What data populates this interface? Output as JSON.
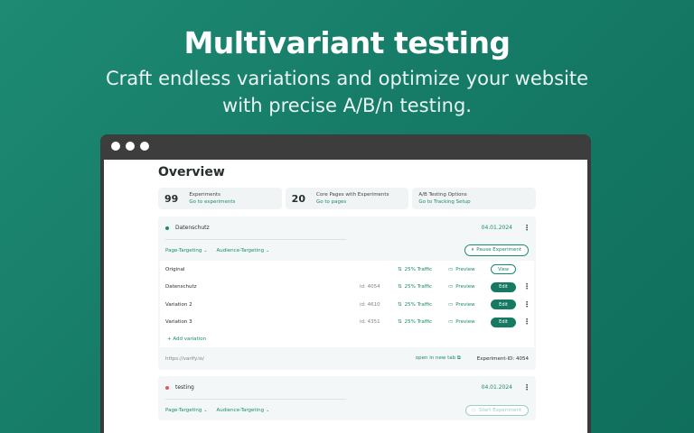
{
  "hero": {
    "title": "Multivariant testing",
    "subtitle_line1": "Craft endless variations and optimize your website",
    "subtitle_line2": "with precise A/B/n testing."
  },
  "overview": {
    "title": "Overview",
    "stats": [
      {
        "number": "99",
        "label": "Experiments",
        "link": "Go to experiments"
      },
      {
        "number": "20",
        "label": "Core Pages with Experiments",
        "link": "Go to pages"
      },
      {
        "number": "",
        "label": "A/B Testing Options",
        "link": "Go to Tracking Setup"
      }
    ]
  },
  "experiments": [
    {
      "name": "Datenschutz",
      "date": "04.01.2024",
      "status_color": "#1a8a6f",
      "targeting": [
        "Page-Targeting",
        "Audience-Targeting"
      ],
      "action_label": "Pause Experiment",
      "variations": [
        {
          "name": "Original",
          "id": "",
          "traffic": "25% Traffic",
          "preview": "Preview",
          "button": "View"
        },
        {
          "name": "Datenschutz",
          "id": "id: 4054",
          "traffic": "25% Traffic",
          "preview": "Preview",
          "button": "Edit"
        },
        {
          "name": "Variation 2",
          "id": "id: 4610",
          "traffic": "25% Traffic",
          "preview": "Preview",
          "button": "Edit"
        },
        {
          "name": "Variation 3",
          "id": "id: 4351",
          "traffic": "25% Traffic",
          "preview": "Preview",
          "button": "Edit"
        }
      ],
      "add_label": "+ Add variation",
      "url": "https://varify.io/",
      "new_tab": "open in new tab",
      "experiment_id": "Experiment-ID: 4054"
    },
    {
      "name": "testing",
      "date": "04.01.2024",
      "status_color": "#e05a5a",
      "targeting": [
        "Page-Targeting",
        "Audience-Targeting"
      ],
      "action_label": "Start Experiment"
    }
  ],
  "colors": {
    "accent": "#1a8a6f",
    "background": "#157a66"
  }
}
